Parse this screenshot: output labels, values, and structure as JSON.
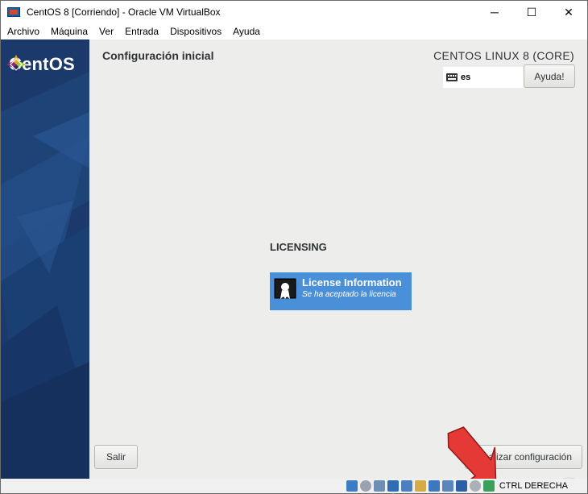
{
  "window": {
    "title": "CentOS 8 [Corriendo] - Oracle VM VirtualBox",
    "controls": {
      "minimize": "─",
      "maximize": "☐",
      "close": "✕"
    }
  },
  "menubar": {
    "items": [
      "Archivo",
      "Máquina",
      "Ver",
      "Entrada",
      "Dispositivos",
      "Ayuda"
    ]
  },
  "installer": {
    "logo_text": "CentOS",
    "page_title": "Configuración inicial",
    "product_title": "CENTOS LINUX 8 (CORE)",
    "keyboard_layout": "es",
    "help_label": "Ayuda!",
    "section_heading": "LICENSING",
    "spoke": {
      "title": "License Information",
      "status": "Se ha aceptado la licencia"
    },
    "quit_label": "Salir",
    "finish_label": "Finalizar configuración"
  },
  "statusbar": {
    "host_key_label": "CTRL DERECHA"
  },
  "colors": {
    "spoke_bg": "#4a90d9",
    "sidebar_bg": "#1b3a6b",
    "arrow": "#e53935",
    "guest_bg": "#ededeb"
  },
  "icons": {
    "app": "virtualbox-icon",
    "keyboard": "keyboard-icon",
    "license": "certificate-icon",
    "annotation": "red-arrow-icon"
  }
}
